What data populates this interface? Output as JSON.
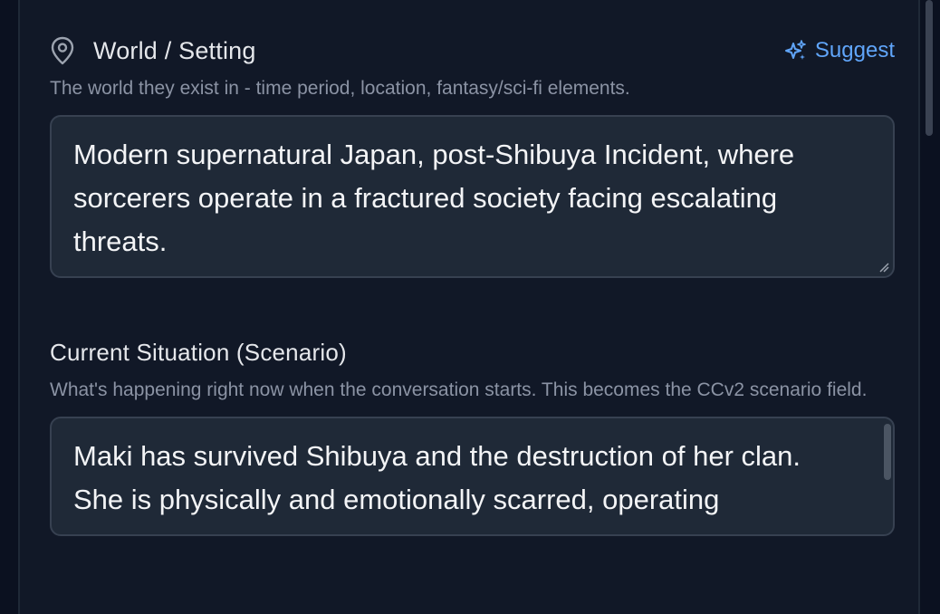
{
  "world": {
    "icon": "map-pin-icon",
    "label": "World / Setting",
    "suggest_icon": "sparkles-icon",
    "suggest_label": "Suggest",
    "hint": "The world they exist in - time period, location, fantasy/sci-fi elements.",
    "value": "Modern supernatural Japan, post-Shibuya Incident, where sorcerers operate in a fractured society facing escalating threats."
  },
  "scenario": {
    "label": "Current Situation (Scenario)",
    "hint": "What's happening right now when the conversation starts. This becomes the CCv2 scenario field.",
    "value": "Maki has survived Shibuya and the destruction of her clan. She is physically and emotionally scarred, operating"
  },
  "colors": {
    "background": "#111827",
    "textbox_bg": "#1f2937",
    "accent": "#60a5fa",
    "text": "#f3f4f6",
    "muted": "#8b93a4"
  }
}
